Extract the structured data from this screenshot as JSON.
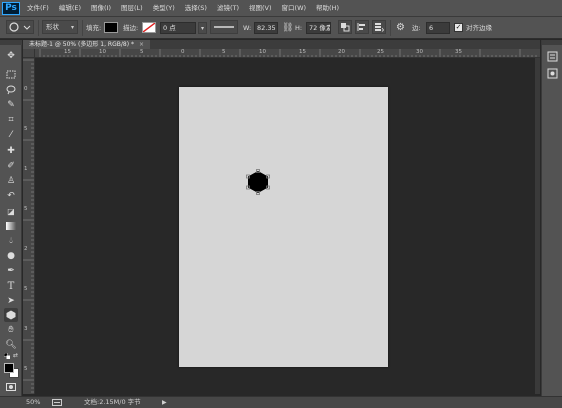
{
  "app": {
    "logo_text": "Ps"
  },
  "menu": [
    "文件(F)",
    "编辑(E)",
    "图像(I)",
    "图层(L)",
    "类型(Y)",
    "选择(S)",
    "滤镜(T)",
    "视图(V)",
    "窗口(W)",
    "帮助(H)"
  ],
  "options": {
    "mode_label": "形状",
    "fill_label": "填充:",
    "stroke_label": "描边:",
    "stroke_width": "0 点",
    "width_label": "W:",
    "width_value": "82.35",
    "height_label": "H:",
    "height_value": "72 像素",
    "sides_label": "边:",
    "sides_value": "6",
    "align_edges_label": "对齐边缘",
    "align_edges_checked": true
  },
  "document": {
    "tab_title": "未标题-1 @ 50% (多边形 1, RGB/8) *",
    "close_glyph": "×",
    "top_ruler_labels": [
      "15",
      "10",
      "5",
      "0",
      "5",
      "10",
      "15",
      "20",
      "25",
      "30",
      "35"
    ],
    "left_ruler_labels": [
      "0",
      "5",
      "1",
      "5",
      "2",
      "5",
      "3",
      "5"
    ]
  },
  "status": {
    "zoom": "50%",
    "doc_info": "文档:2.15M/0 字节"
  },
  "colors": {
    "ui_panel": "#535353",
    "pasteboard": "#282828",
    "canvas": "#d6d6d6",
    "shape_fill": "#000000",
    "accent": "#31a8ff"
  }
}
